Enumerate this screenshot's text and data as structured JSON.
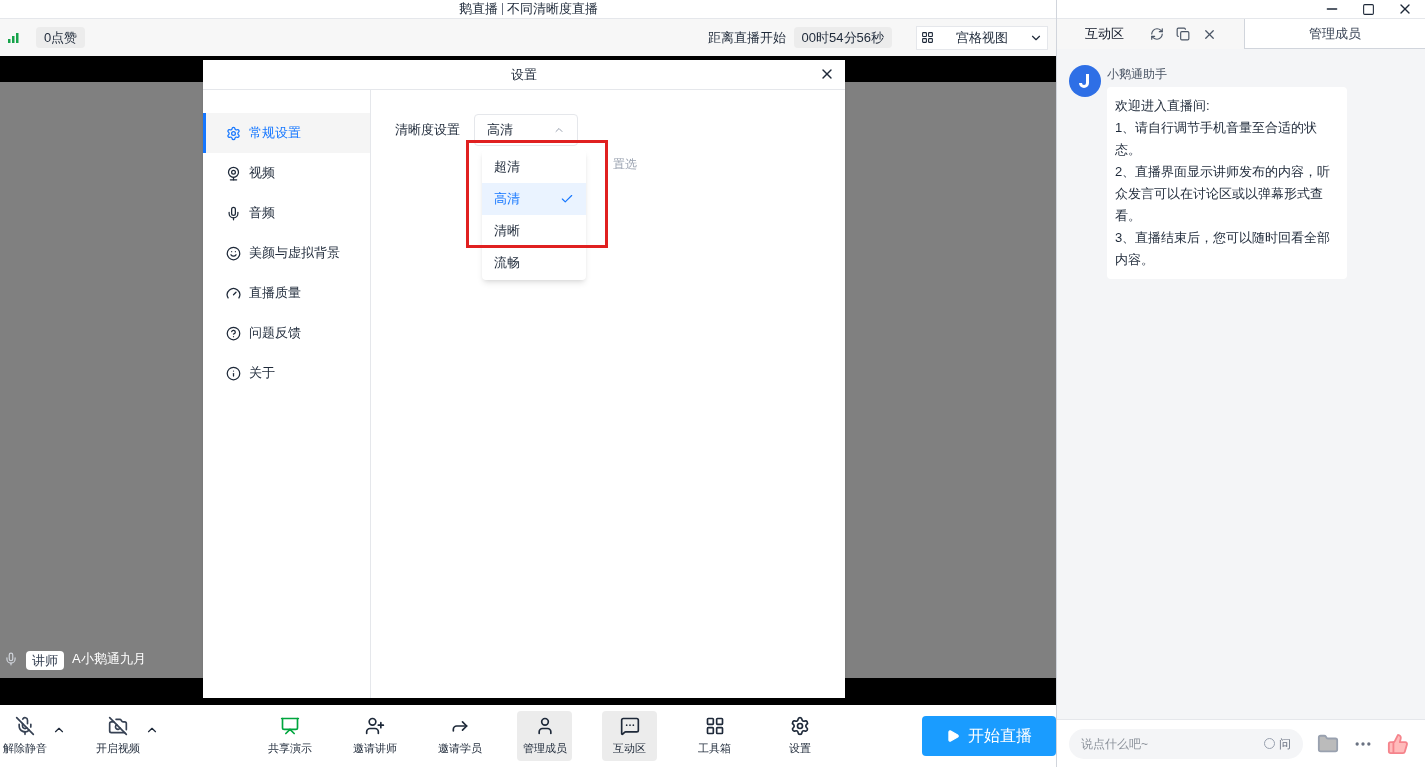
{
  "window": {
    "app_name": "鹅直播",
    "title": "不同清晰度直播"
  },
  "top_bar": {
    "likes": "0点赞",
    "countdown_label": "距离直播开始",
    "countdown": "00时54分56秒",
    "view_select": "宫格视图"
  },
  "video": {
    "speaker_role": "讲师",
    "speaker_name": "A小鹅通九月"
  },
  "dialog": {
    "title": "设置",
    "nav": [
      {
        "label": "常规设置",
        "selected": true
      },
      {
        "label": "视频",
        "selected": false
      },
      {
        "label": "音频",
        "selected": false
      },
      {
        "label": "美颜与虚拟背景",
        "selected": false
      },
      {
        "label": "直播质量",
        "selected": false
      },
      {
        "label": "问题反馈",
        "selected": false
      },
      {
        "label": "关于",
        "selected": false
      }
    ],
    "setting_label": "清晰度设置",
    "select_value": "高清",
    "expanded": true,
    "options": [
      {
        "label": "超清",
        "selected": false
      },
      {
        "label": "高清",
        "selected": true
      },
      {
        "label": "清晰",
        "selected": false
      },
      {
        "label": "流畅",
        "selected": false
      }
    ],
    "hidden_hint": "置选"
  },
  "bottom_toolbar": {
    "left": [
      {
        "label": "解除静音"
      },
      {
        "label": "开启视频"
      }
    ],
    "center": [
      {
        "label": "共享演示",
        "active": false
      },
      {
        "label": "邀请讲师",
        "active": false
      },
      {
        "label": "邀请学员",
        "active": false
      },
      {
        "label": "管理成员",
        "active": true
      },
      {
        "label": "互动区",
        "active": true
      },
      {
        "label": "工具箱",
        "active": false
      },
      {
        "label": "设置",
        "active": false
      }
    ],
    "start_button": "开始直播"
  },
  "side_panel": {
    "tabs": [
      {
        "label": "互动区",
        "selected": true
      },
      {
        "label": "管理成员",
        "selected": false
      }
    ],
    "message": {
      "sender": "小鹅通助手",
      "lines": [
        "欢迎进入直播间:",
        "1、请自行调节手机音量至合适的状态。",
        "2、直播界面显示讲师发布的内容，听众发言可以在讨论区或以弹幕形式查看。",
        "3、直播结束后，您可以随时回看全部内容。"
      ]
    },
    "input_placeholder": "说点什么吧~",
    "question_toggle": {
      "label": "问",
      "checked": false
    }
  }
}
